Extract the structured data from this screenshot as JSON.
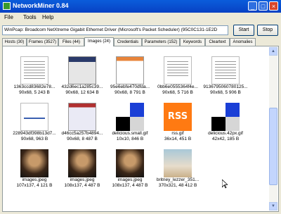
{
  "window": {
    "title": "NetworkMiner 0.84"
  },
  "menu": {
    "items": [
      "File",
      "Tools",
      "Help"
    ]
  },
  "adapter": {
    "selected": "WinPcap: Broadcom NetXtreme Gigabit Ethernet Driver (Microsoft's Packet Scheduler) (95C0C131-1E2D"
  },
  "buttons": {
    "start": "Start",
    "stop": "Stop"
  },
  "tabs": [
    "Hosts (30)",
    "Frames (3527)",
    "Files (44)",
    "Images (24)",
    "Credentials",
    "Parameters (152)",
    "Keywords",
    "Cleartext",
    "Anomalies"
  ],
  "images": [
    {
      "name": "1363ccd83682e78...",
      "dims": "90x68, 5 243 B"
    },
    {
      "name": "432d6ec1a285c39...",
      "dims": "90x68, 12 634 B"
    },
    {
      "name": "95e6ebfe470dfda...",
      "dims": "90x68, 8 791 B"
    },
    {
      "name": "0bb6e0555364f4e...",
      "dims": "90x68, 5 716 B"
    },
    {
      "name": "9136795060780125...",
      "dims": "90x68, 5 906 B"
    },
    {
      "name": "228943df398b13d7...",
      "dims": "90x68, 963 B"
    },
    {
      "name": "d46cc5a257b4894...",
      "dims": "90x68, 8 487 B"
    },
    {
      "name": "delicious.small.gif",
      "dims": "10x10, 846 B"
    },
    {
      "name": "rss.gif",
      "dims": "36x14, 451 B"
    },
    {
      "name": "delicious.42px.gif",
      "dims": "42x42, 185 B"
    },
    {
      "name": "images.jpeg",
      "dims": "107x137, 4 121 B"
    },
    {
      "name": "images.jpeg",
      "dims": "108x137, 4 487 B"
    },
    {
      "name": "images.jpeg",
      "dims": "108x137, 4 487 B"
    },
    {
      "name": "britney_lezzer_351...",
      "dims": "370x321, 48 412 B"
    }
  ],
  "rss_text": "RSS"
}
